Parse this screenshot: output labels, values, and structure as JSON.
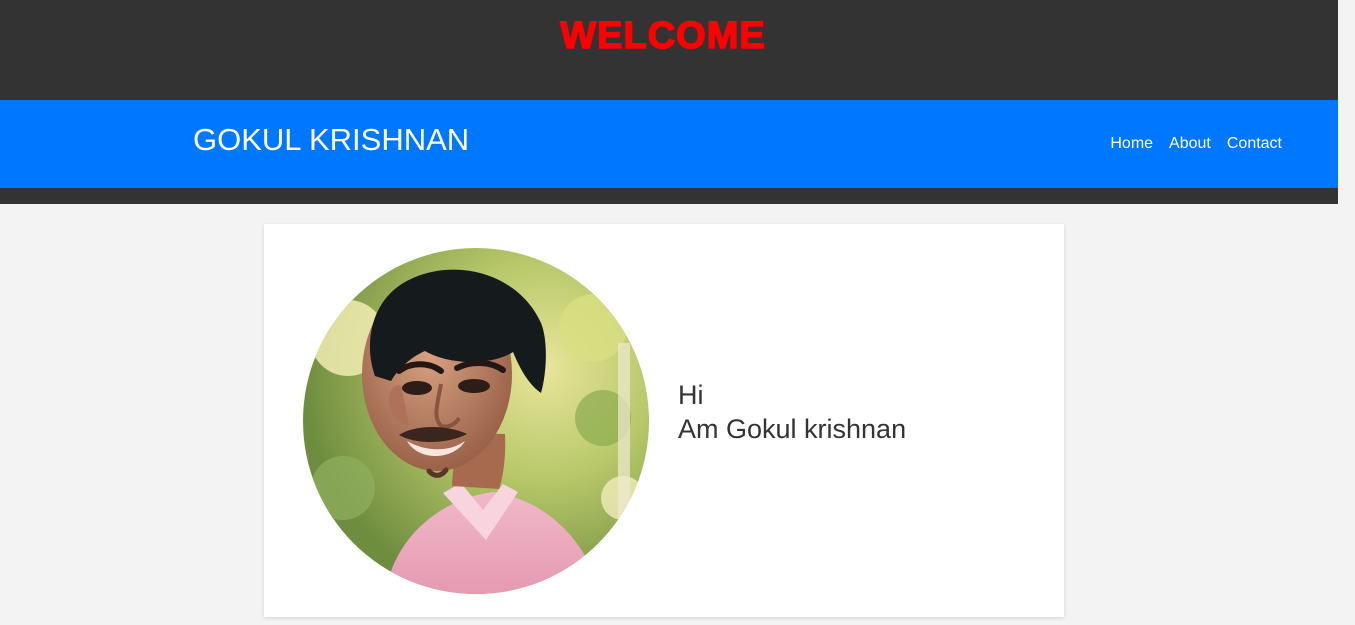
{
  "banner": {
    "welcome_text": "WELCOME"
  },
  "navbar": {
    "brand": "GOKUL KRISHNAN",
    "links": [
      {
        "label": "Home"
      },
      {
        "label": "About"
      },
      {
        "label": "Contact"
      }
    ]
  },
  "profile": {
    "photo_icon": "profile-photo",
    "greeting": "Hi",
    "intro": "Am Gokul krishnan"
  },
  "scrollbar": {
    "up_icon": "scroll-up-arrow-icon",
    "down_icon": "scroll-down-arrow-icon"
  },
  "colors": {
    "banner_bg": "#333333",
    "welcome": "#ff0000",
    "navbar_bg": "#0077ff",
    "page_bg": "#f3f3f3",
    "text": "#333333"
  }
}
